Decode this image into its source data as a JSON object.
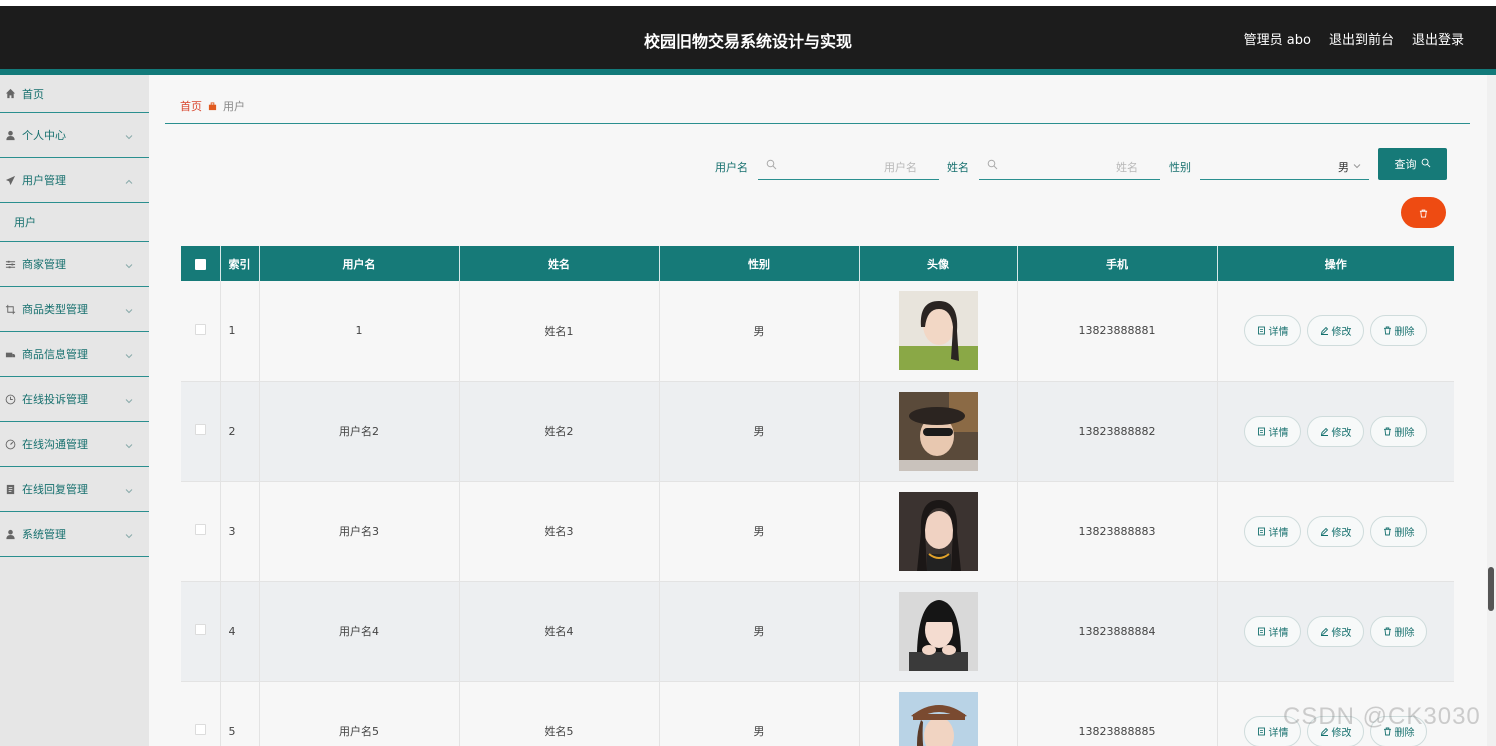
{
  "header": {
    "title": "校园旧物交易系统设计与实现",
    "admin_label": "管理员 abo",
    "front_label": "退出到前台",
    "logout_label": "退出登录"
  },
  "sidebar": {
    "items": [
      {
        "label": "首页",
        "icon": "home-icon"
      },
      {
        "label": "个人中心",
        "icon": "user-icon"
      },
      {
        "label": "用户管理",
        "icon": "send-icon"
      },
      {
        "label": "用户",
        "icon": ""
      },
      {
        "label": "商家管理",
        "icon": "sliders-icon"
      },
      {
        "label": "商品类型管理",
        "icon": "crop-icon"
      },
      {
        "label": "商品信息管理",
        "icon": "truck-icon"
      },
      {
        "label": "在线投诉管理",
        "icon": "clock-icon"
      },
      {
        "label": "在线沟通管理",
        "icon": "gauge-icon"
      },
      {
        "label": "在线回复管理",
        "icon": "document-icon"
      },
      {
        "label": "系统管理",
        "icon": "user-icon"
      }
    ]
  },
  "breadcrumb": {
    "home": "首页",
    "current": "用户"
  },
  "search": {
    "username_label": "用户名",
    "username_placeholder": "用户名",
    "name_label": "姓名",
    "name_placeholder": "姓名",
    "gender_label": "性别",
    "gender_value": "男",
    "query_label": "查询"
  },
  "table": {
    "headers": [
      "索引",
      "用户名",
      "姓名",
      "性别",
      "头像",
      "手机",
      "操作"
    ],
    "rows": [
      {
        "index": "1",
        "username": "1",
        "name": "姓名1",
        "gender": "男",
        "phone": "13823888881"
      },
      {
        "index": "2",
        "username": "用户名2",
        "name": "姓名2",
        "gender": "男",
        "phone": "13823888882"
      },
      {
        "index": "3",
        "username": "用户名3",
        "name": "姓名3",
        "gender": "男",
        "phone": "13823888883"
      },
      {
        "index": "4",
        "username": "用户名4",
        "name": "姓名4",
        "gender": "男",
        "phone": "13823888884"
      },
      {
        "index": "5",
        "username": "用户名5",
        "name": "姓名5",
        "gender": "男",
        "phone": "13823888885"
      }
    ],
    "actions": {
      "detail": "详情",
      "edit": "修改",
      "delete": "删除"
    }
  },
  "watermark": "CSDN @CK3030",
  "colors": {
    "header": "#1c1c1c",
    "accent": "#167a78",
    "danger": "#ee4b12",
    "breadcrumb_home": "#d9462e"
  }
}
